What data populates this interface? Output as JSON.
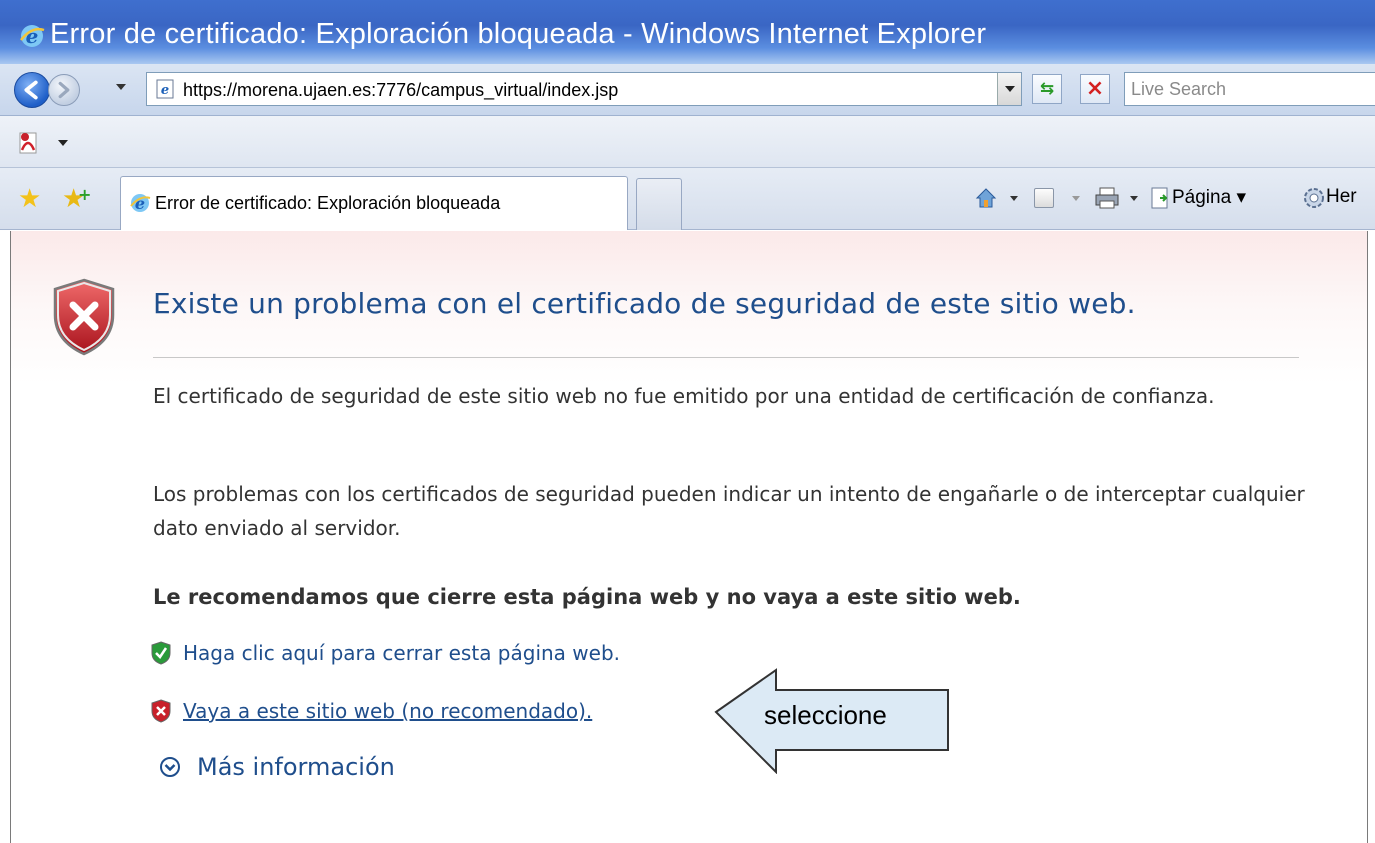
{
  "window": {
    "title": "Error de certificado: Exploración bloqueada - Windows Internet Explorer"
  },
  "address_bar": {
    "url": "https://morena.ujaen.es:7776/campus_virtual/index.jsp"
  },
  "search": {
    "placeholder": "Live Search"
  },
  "tab": {
    "label": "Error de certificado: Exploración bloqueada"
  },
  "command_bar": {
    "page_label": "Página",
    "tools_label": "Her"
  },
  "content": {
    "heading": "Existe un problema con el certificado de seguridad de este sitio web.",
    "paragraph1": "El certificado de seguridad de este sitio web no fue emitido por una entidad de certificación de confianza.",
    "paragraph2": "Los problemas con los certificados de seguridad pueden indicar un intento de engañarle o de interceptar cualquier dato enviado al servidor.",
    "recommendation": "Le recomendamos que cierre esta página web y no vaya a este sitio web.",
    "close_link": "Haga clic aquí para cerrar esta página web.",
    "continue_link": "Vaya a este sitio web (no recomendado).",
    "more_info": "Más información"
  },
  "annotation": {
    "callout_text": "seleccione"
  },
  "colors": {
    "title_bar": "#3a66c4",
    "link": "#1f4e8c",
    "error_red": "#c8202a",
    "safe_green": "#2a9a3a",
    "callout_fill": "#dceaf5"
  },
  "icons": [
    "ie-logo-icon",
    "back-icon",
    "forward-icon",
    "refresh-icon",
    "stop-icon",
    "adobe-icon",
    "favorites-star-icon",
    "add-favorites-icon",
    "home-icon",
    "feeds-icon",
    "print-icon",
    "page-icon",
    "tools-icon",
    "error-shield-icon",
    "green-shield-icon",
    "red-shield-icon",
    "expand-circle-icon"
  ]
}
